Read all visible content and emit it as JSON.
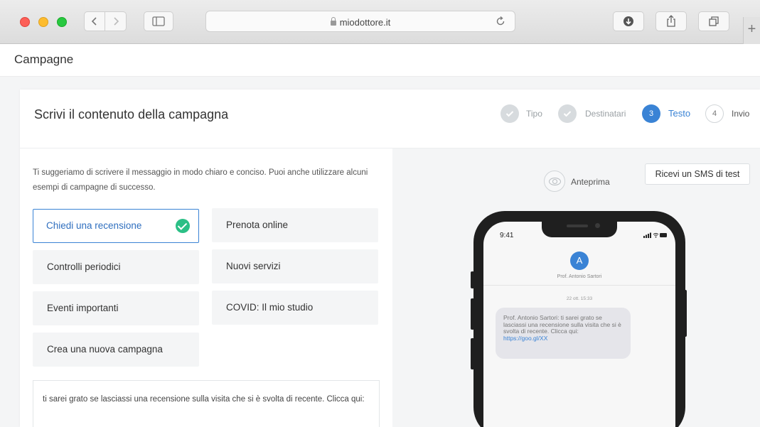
{
  "browser": {
    "url": "miodottore.it",
    "new_tab_label": "+"
  },
  "page": {
    "title": "Campagne"
  },
  "card": {
    "title": "Scrivi il contenuto della campagna"
  },
  "stepper": {
    "steps": [
      {
        "label": "Tipo",
        "state": "done"
      },
      {
        "label": "Destinatari",
        "state": "done"
      },
      {
        "number": "3",
        "label": "Testo",
        "state": "active"
      },
      {
        "number": "4",
        "label": "Invio",
        "state": "todo"
      }
    ]
  },
  "intro_text": "Ti suggeriamo di scrivere il messaggio in modo chiaro e conciso. Puoi anche utilizzare alcuni esempi di campagne di successo.",
  "templates": [
    {
      "label": "Chiedi una recensione",
      "selected": true
    },
    {
      "label": "Prenota online"
    },
    {
      "label": "Controlli periodici"
    },
    {
      "label": "Nuovi servizi"
    },
    {
      "label": "Eventi importanti"
    },
    {
      "label": "COVID: Il mio studio"
    },
    {
      "label": "Crea una nuova campagna"
    }
  ],
  "message_text": "ti sarei grato se lasciassi una recensione sulla visita che si è svolta di recente. Clicca qui:",
  "preview": {
    "label": "Anteprima",
    "sms_test_button": "Ricevi un SMS di test"
  },
  "phone": {
    "time": "9:41",
    "avatar_letter": "A",
    "contact_name": "Prof. Antonio Sartori",
    "date": "22 ott. 15:33",
    "bubble_text": "Prof. Antonio Sartori: ti sarei grato se lasciassi una recensione sulla visita che si è svolta di recente. Clicca qui:",
    "bubble_link": "https://goo.gl/XX"
  },
  "colors": {
    "accent": "#3a83d5",
    "success": "#2bbf86"
  }
}
